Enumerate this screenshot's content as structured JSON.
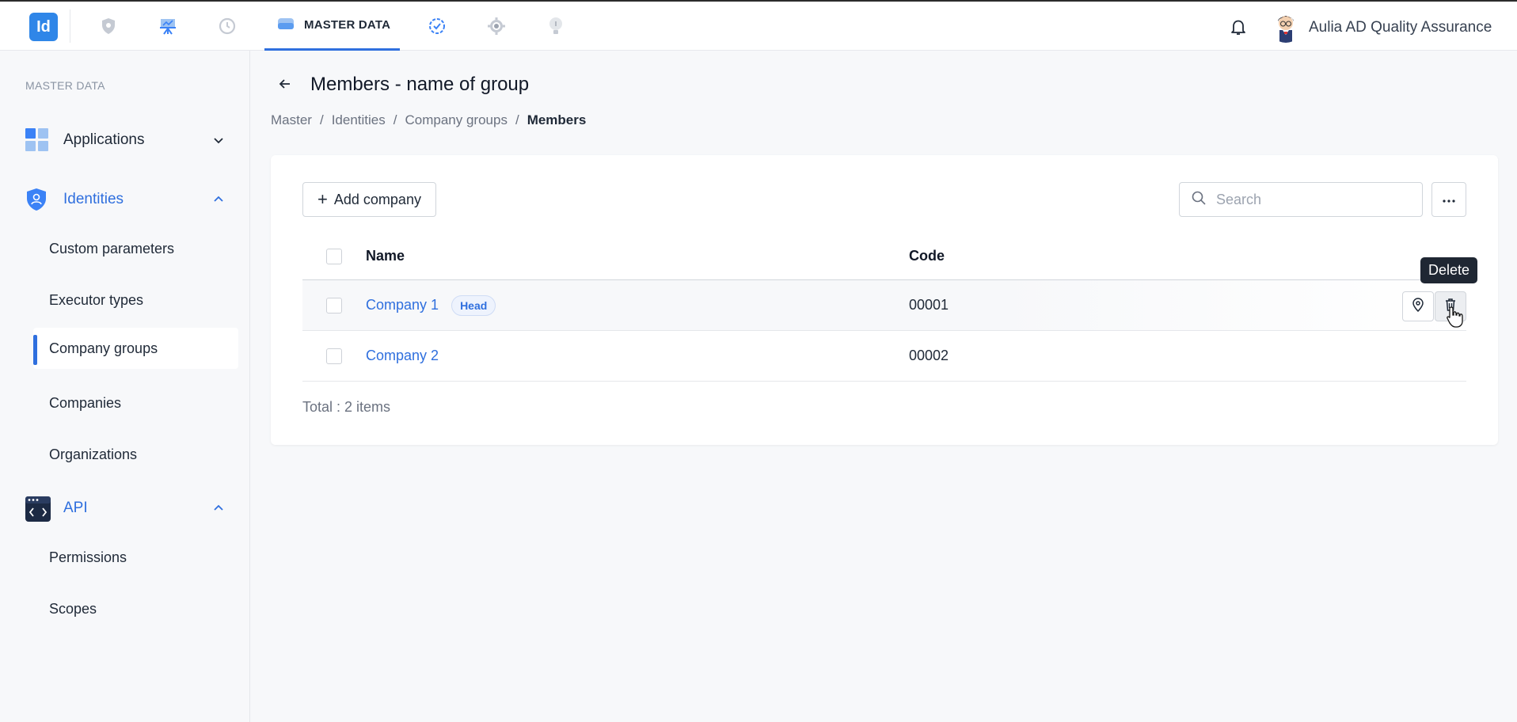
{
  "topbar": {
    "logo_text": "Id",
    "nav": [
      {
        "icon": "shield-icon"
      },
      {
        "icon": "presentation-icon"
      },
      {
        "icon": "history-icon"
      },
      {
        "icon": "database-icon",
        "label": "MASTER DATA",
        "active": true
      },
      {
        "icon": "check-badge-icon"
      },
      {
        "icon": "gear-icon"
      },
      {
        "icon": "lightbulb-icon"
      }
    ],
    "user_name": "Aulia AD Quality Assurance",
    "accent": "#2f6fde"
  },
  "sidebar": {
    "section_title": "MASTER DATA",
    "groups": [
      {
        "label": "Applications",
        "icon": "grid-icon",
        "expanded": false
      },
      {
        "label": "Identities",
        "icon": "shield-user-icon",
        "expanded": true,
        "items": [
          "Custom parameters",
          "Executor types",
          "Company groups",
          "Companies",
          "Organizations"
        ]
      },
      {
        "label": "API",
        "icon": "code-window-icon",
        "expanded": true,
        "items": [
          "Permissions",
          "Scopes"
        ]
      }
    ],
    "active_item": "Company groups"
  },
  "page": {
    "title": "Members - name of group",
    "breadcrumb": [
      "Master",
      "Identities",
      "Company groups",
      "Members"
    ]
  },
  "toolbar": {
    "add_label": "Add company",
    "search_placeholder": "Search"
  },
  "table": {
    "columns": [
      "Name",
      "Code"
    ],
    "rows": [
      {
        "name": "Company 1",
        "badge": "Head",
        "code": "00001"
      },
      {
        "name": "Company 2",
        "badge": "",
        "code": "00002"
      }
    ],
    "total": "Total : 2 items"
  },
  "tooltip": "Delete"
}
